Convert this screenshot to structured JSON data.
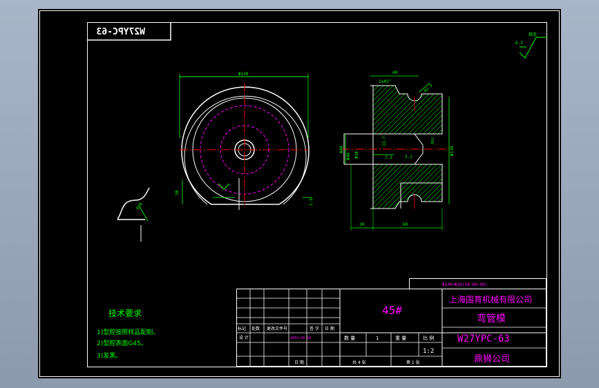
{
  "drawing": {
    "part_code_mirrored": "W27YPC-63",
    "surface_finish_note": "其余",
    "surface_finish_value": "6.3",
    "front_view": {
      "dia_label": "Φ130",
      "height_label": "30",
      "slot_label": "1.5"
    },
    "detail_view": {
      "surface_value": "0.8"
    },
    "section_view": {
      "top_width": "40",
      "chamfer": "1x45°",
      "radius": "R2.5",
      "bore_dims": [
        "Φ48",
        "Φ40",
        "Φ38"
      ],
      "inner_width": "7.5",
      "inner_value": "3.2",
      "thread": "M12",
      "outer_height": "Φ130",
      "bottom_left": "20",
      "bottom_total": "60",
      "left_small": "13.7"
    }
  },
  "tech_requirements": {
    "title": "技术要求",
    "items": [
      "1)型腔按照样品配制。",
      "2)型腔表面G45。",
      "3)发黑。"
    ]
  },
  "title_block": {
    "header_note": "Φ130×Φ36(50-60-90)",
    "material": "45#",
    "company": "上海国育机械有限公司",
    "part_name": "弯管模",
    "part_code": "W27YPC-63",
    "owner": "鼎狮公司",
    "scale_label": "比 例",
    "scale_value": "1:2",
    "quantity_label": "数 量",
    "quantity_value": "1",
    "weight_label": "重 量",
    "sheet_total": "共 4 张",
    "sheet_num": "第 1 张",
    "row_labels": [
      "标记",
      "处数",
      "更改文件号",
      "签 字",
      "日 期"
    ],
    "design_label": "设 计",
    "design_date": "2019-03-19",
    "date_label": "日 期"
  }
}
